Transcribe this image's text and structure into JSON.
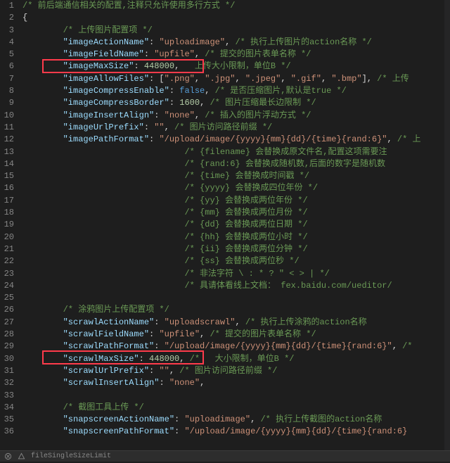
{
  "lines": [
    {
      "n": 1,
      "i": 0,
      "seg": [
        {
          "c": "cm",
          "t": "/* 前后端通信相关的配置,注释只允许使用多行方式 */"
        }
      ]
    },
    {
      "n": 2,
      "i": 0,
      "seg": [
        {
          "c": "pun",
          "t": "{"
        }
      ]
    },
    {
      "n": 3,
      "i": 2,
      "seg": [
        {
          "c": "cm",
          "t": "/* 上传图片配置项 */"
        }
      ]
    },
    {
      "n": 4,
      "i": 2,
      "seg": [
        {
          "c": "key",
          "t": "\"imageActionName\""
        },
        {
          "c": "pun",
          "t": ": "
        },
        {
          "c": "str",
          "t": "\"uploadimage\""
        },
        {
          "c": "pun",
          "t": ", "
        },
        {
          "c": "cm",
          "t": "/* 执行上传图片的action名称 */"
        }
      ]
    },
    {
      "n": 5,
      "i": 2,
      "seg": [
        {
          "c": "key",
          "t": "\"imageFieldName\""
        },
        {
          "c": "pun",
          "t": ": "
        },
        {
          "c": "str",
          "t": "\"upfile\""
        },
        {
          "c": "pun",
          "t": ", "
        },
        {
          "c": "cm",
          "t": "/* 提交的图片表单名称 */"
        }
      ]
    },
    {
      "n": 6,
      "i": 2,
      "seg": [
        {
          "c": "key",
          "t": "\"imageMaxSize\""
        },
        {
          "c": "pun",
          "t": ": "
        },
        {
          "c": "num",
          "t": "448000"
        },
        {
          "c": "pun",
          "t": ", "
        },
        {
          "c": "cm",
          "t": "  上传大小限制，单位B */"
        }
      ]
    },
    {
      "n": 7,
      "i": 2,
      "seg": [
        {
          "c": "key",
          "t": "\"imageAllowFiles\""
        },
        {
          "c": "pun",
          "t": ": ["
        },
        {
          "c": "str",
          "t": "\".png\""
        },
        {
          "c": "pun",
          "t": ", "
        },
        {
          "c": "str",
          "t": "\".jpg\""
        },
        {
          "c": "pun",
          "t": ", "
        },
        {
          "c": "str",
          "t": "\".jpeg\""
        },
        {
          "c": "pun",
          "t": ", "
        },
        {
          "c": "str",
          "t": "\".gif\""
        },
        {
          "c": "pun",
          "t": ", "
        },
        {
          "c": "str",
          "t": "\".bmp\""
        },
        {
          "c": "pun",
          "t": "], "
        },
        {
          "c": "cm",
          "t": "/* 上传"
        }
      ]
    },
    {
      "n": 8,
      "i": 2,
      "seg": [
        {
          "c": "key",
          "t": "\"imageCompressEnable\""
        },
        {
          "c": "pun",
          "t": ": "
        },
        {
          "c": "bool",
          "t": "false"
        },
        {
          "c": "pun",
          "t": ", "
        },
        {
          "c": "cm",
          "t": "/* 是否压缩图片,默认是true */"
        }
      ]
    },
    {
      "n": 9,
      "i": 2,
      "seg": [
        {
          "c": "key",
          "t": "\"imageCompressBorder\""
        },
        {
          "c": "pun",
          "t": ": "
        },
        {
          "c": "num",
          "t": "1600"
        },
        {
          "c": "pun",
          "t": ", "
        },
        {
          "c": "cm",
          "t": "/* 图片压缩最长边限制 */"
        }
      ]
    },
    {
      "n": 10,
      "i": 2,
      "seg": [
        {
          "c": "key",
          "t": "\"imageInsertAlign\""
        },
        {
          "c": "pun",
          "t": ": "
        },
        {
          "c": "str",
          "t": "\"none\""
        },
        {
          "c": "pun",
          "t": ", "
        },
        {
          "c": "cm",
          "t": "/* 插入的图片浮动方式 */"
        }
      ]
    },
    {
      "n": 11,
      "i": 2,
      "seg": [
        {
          "c": "key",
          "t": "\"imageUrlPrefix\""
        },
        {
          "c": "pun",
          "t": ": "
        },
        {
          "c": "str",
          "t": "\"\""
        },
        {
          "c": "pun",
          "t": ", "
        },
        {
          "c": "cm",
          "t": "/* 图片访问路径前缀 */"
        }
      ]
    },
    {
      "n": 12,
      "i": 2,
      "seg": [
        {
          "c": "key",
          "t": "\"imagePathFormat\""
        },
        {
          "c": "pun",
          "t": ": "
        },
        {
          "c": "str",
          "t": "\"/upload/image/{yyyy}{mm}{dd}/{time}{rand:6}\""
        },
        {
          "c": "pun",
          "t": ", "
        },
        {
          "c": "cm",
          "t": "/* 上"
        }
      ]
    },
    {
      "n": 13,
      "i": 8,
      "seg": [
        {
          "c": "cm",
          "t": "/* {filename} 会替换成原文件名,配置这项需要注"
        }
      ]
    },
    {
      "n": 14,
      "i": 8,
      "seg": [
        {
          "c": "cm",
          "t": "/* {rand:6} 会替换成随机数,后面的数字是随机数"
        }
      ]
    },
    {
      "n": 15,
      "i": 8,
      "seg": [
        {
          "c": "cm",
          "t": "/* {time} 会替换成时间戳 */"
        }
      ]
    },
    {
      "n": 16,
      "i": 8,
      "seg": [
        {
          "c": "cm",
          "t": "/* {yyyy} 会替换成四位年份 */"
        }
      ]
    },
    {
      "n": 17,
      "i": 8,
      "seg": [
        {
          "c": "cm",
          "t": "/* {yy} 会替换成两位年份 */"
        }
      ]
    },
    {
      "n": 18,
      "i": 8,
      "seg": [
        {
          "c": "cm",
          "t": "/* {mm} 会替换成两位月份 */"
        }
      ]
    },
    {
      "n": 19,
      "i": 8,
      "seg": [
        {
          "c": "cm",
          "t": "/* {dd} 会替换成两位日期 */"
        }
      ]
    },
    {
      "n": 20,
      "i": 8,
      "seg": [
        {
          "c": "cm",
          "t": "/* {hh} 会替换成两位小时 */"
        }
      ]
    },
    {
      "n": 21,
      "i": 8,
      "seg": [
        {
          "c": "cm",
          "t": "/* {ii} 会替换成两位分钟 */"
        }
      ]
    },
    {
      "n": 22,
      "i": 8,
      "seg": [
        {
          "c": "cm",
          "t": "/* {ss} 会替换成两位秒 */"
        }
      ]
    },
    {
      "n": 23,
      "i": 8,
      "seg": [
        {
          "c": "cm",
          "t": "/* 非法字符 \\ : * ? \" < > | */"
        }
      ]
    },
    {
      "n": 24,
      "i": 8,
      "seg": [
        {
          "c": "cm",
          "t": "/* 具请体看线上文档： fex.baidu.com/ueditor/"
        }
      ]
    },
    {
      "n": 25,
      "i": 0,
      "seg": []
    },
    {
      "n": 26,
      "i": 2,
      "seg": [
        {
          "c": "cm",
          "t": "/* 涂鸦图片上传配置项 */"
        }
      ]
    },
    {
      "n": 27,
      "i": 2,
      "seg": [
        {
          "c": "key",
          "t": "\"scrawlActionName\""
        },
        {
          "c": "pun",
          "t": ": "
        },
        {
          "c": "str",
          "t": "\"uploadscrawl\""
        },
        {
          "c": "pun",
          "t": ", "
        },
        {
          "c": "cm",
          "t": "/* 执行上传涂鸦的action名称"
        }
      ]
    },
    {
      "n": 28,
      "i": 2,
      "seg": [
        {
          "c": "key",
          "t": "\"scrawlFieldName\""
        },
        {
          "c": "pun",
          "t": ": "
        },
        {
          "c": "str",
          "t": "\"upfile\""
        },
        {
          "c": "pun",
          "t": ", "
        },
        {
          "c": "cm",
          "t": "/* 提交的图片表单名称 */"
        }
      ]
    },
    {
      "n": 29,
      "i": 2,
      "seg": [
        {
          "c": "key",
          "t": "\"scrawlPathFormat\""
        },
        {
          "c": "pun",
          "t": ": "
        },
        {
          "c": "str",
          "t": "\"/upload/image/{yyyy}{mm}{dd}/{time}{rand:6}\""
        },
        {
          "c": "pun",
          "t": ", "
        },
        {
          "c": "cm",
          "t": "/*"
        }
      ]
    },
    {
      "n": 30,
      "i": 2,
      "seg": [
        {
          "c": "key",
          "t": "\"scrawlMaxSize\""
        },
        {
          "c": "pun",
          "t": ": "
        },
        {
          "c": "num",
          "t": "448000"
        },
        {
          "c": "pun",
          "t": ", "
        },
        {
          "c": "cm",
          "t": "/*   大小限制，单位B */"
        }
      ]
    },
    {
      "n": 31,
      "i": 2,
      "seg": [
        {
          "c": "key",
          "t": "\"scrawlUrlPrefix\""
        },
        {
          "c": "pun",
          "t": ": "
        },
        {
          "c": "str",
          "t": "\"\""
        },
        {
          "c": "pun",
          "t": ", "
        },
        {
          "c": "cm",
          "t": "/* 图片访问路径前缀 */"
        }
      ]
    },
    {
      "n": 32,
      "i": 2,
      "seg": [
        {
          "c": "key",
          "t": "\"scrawlInsertAlign\""
        },
        {
          "c": "pun",
          "t": ": "
        },
        {
          "c": "str",
          "t": "\"none\""
        },
        {
          "c": "pun",
          "t": ","
        }
      ]
    },
    {
      "n": 33,
      "i": 0,
      "seg": []
    },
    {
      "n": 34,
      "i": 2,
      "seg": [
        {
          "c": "cm",
          "t": "/* 截图工具上传 */"
        }
      ]
    },
    {
      "n": 35,
      "i": 2,
      "seg": [
        {
          "c": "key",
          "t": "\"snapscreenActionName\""
        },
        {
          "c": "pun",
          "t": ": "
        },
        {
          "c": "str",
          "t": "\"uploadimage\""
        },
        {
          "c": "pun",
          "t": ", "
        },
        {
          "c": "cm",
          "t": "/* 执行上传截图的action名称"
        }
      ]
    },
    {
      "n": 36,
      "i": 2,
      "seg": [
        {
          "c": "key",
          "t": "\"snapscreenPathFormat\""
        },
        {
          "c": "pun",
          "t": ": "
        },
        {
          "c": "str",
          "t": "\"/upload/image/{yyyy}{mm}{dd}/{time}{rand:6}"
        }
      ]
    }
  ],
  "status": {
    "hint": "fileSingleSizeLimit"
  }
}
